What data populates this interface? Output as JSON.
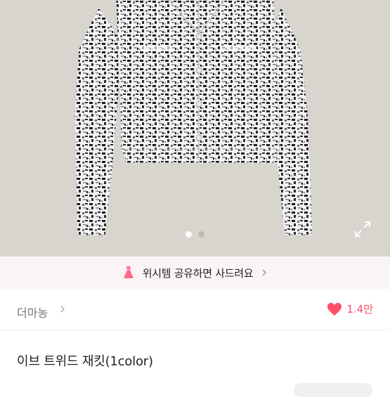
{
  "gallery": {
    "slide_count": 2,
    "active_index": 0,
    "expand_icon": "expand-arrows-icon"
  },
  "banner": {
    "icon": "dress-icon",
    "text": "위시템 공유하면 사드려요",
    "chevron_icon": "chevron-right-icon"
  },
  "shop": {
    "name": "더마농",
    "chevron_icon": "chevron-right-icon"
  },
  "likes": {
    "icon": "heart-icon",
    "count": "1.4만",
    "color": "#ff4d6a"
  },
  "product": {
    "title": "이브 트위드 재킷(1color)"
  },
  "colors": {
    "hero_background": "#d8d5ce",
    "banner_background": "#fbf4f6",
    "accent_pink": "#ff4d6a"
  }
}
